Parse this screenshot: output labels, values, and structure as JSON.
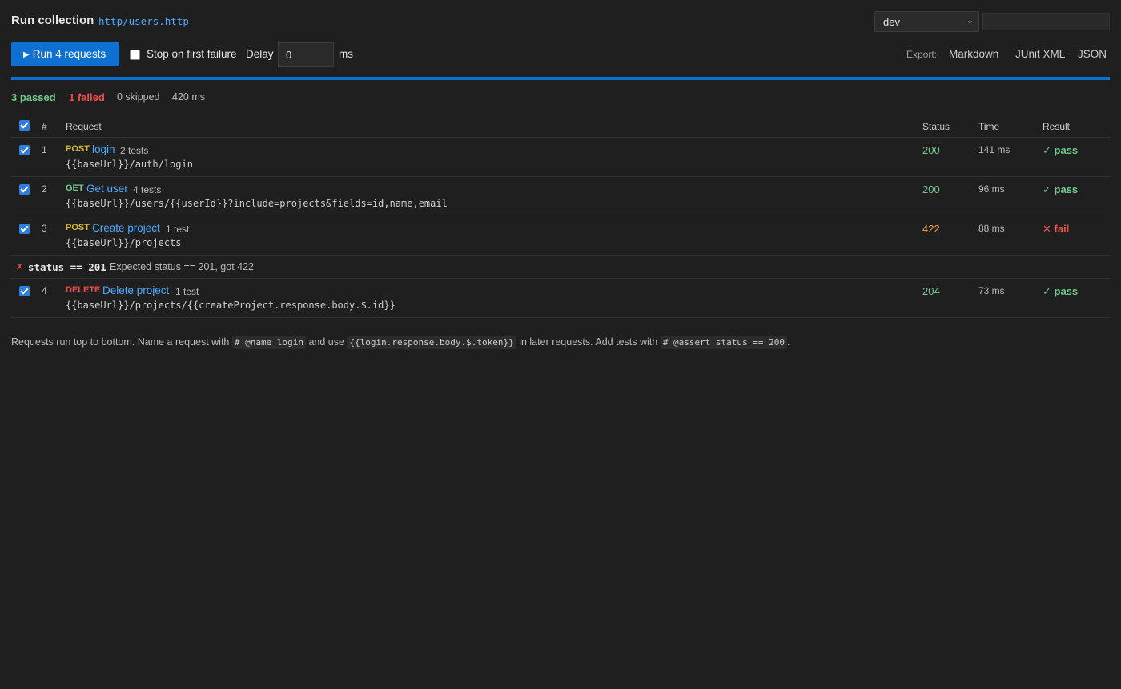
{
  "header": {
    "title": "Run collection",
    "file": "http/users.http",
    "environment": "dev"
  },
  "toolbar": {
    "run_label": "Run 4 requests",
    "stop_on_failure_label": "Stop on first failure",
    "stop_on_failure_checked": false,
    "delay_label": "Delay",
    "delay_value": "0",
    "delay_unit": "ms",
    "export_label": "Export:",
    "export_options": [
      "Markdown",
      "JUnit XML",
      "JSON"
    ]
  },
  "progress": {
    "fraction": 1.0
  },
  "summary": {
    "passed": "3 passed",
    "failed": "1 failed",
    "skipped": "0 skipped",
    "duration": "420 ms"
  },
  "table": {
    "headers": {
      "num": "#",
      "request": "Request",
      "status": "Status",
      "time": "Time",
      "result": "Result"
    },
    "rows": [
      {
        "num": "1",
        "method": "POST",
        "name": "login",
        "tests": "2 tests",
        "url": "{{baseUrl}}/auth/login",
        "status": "200",
        "time": "141 ms",
        "result": "pass"
      },
      {
        "num": "2",
        "method": "GET",
        "name": "Get user",
        "tests": "4 tests",
        "url": "{{baseUrl}}/users/{{userId}}?include=projects&fields=id,name,email",
        "status": "200",
        "time": "96 ms",
        "result": "pass"
      },
      {
        "num": "3",
        "method": "POST",
        "name": "Create project",
        "tests": "1 test",
        "url": "{{baseUrl}}/projects",
        "status": "422",
        "time": "88 ms",
        "result": "fail"
      },
      {
        "num": "4",
        "method": "DELETE",
        "name": "Delete project",
        "tests": "1 test",
        "url": "{{baseUrl}}/projects/{{createProject.response.body.$.id}}",
        "status": "204",
        "time": "73 ms",
        "result": "pass"
      }
    ],
    "failure": {
      "marker": "✗",
      "expression": "status == 201",
      "message": "Expected status == 201, got 422"
    }
  },
  "hint": {
    "t1": "Requests run top to bottom. Name a request with",
    "c1": "# @name login",
    "t2": "and use",
    "c2": "{{login.response.body.$.token}}",
    "t3": "in later requests. Add tests with",
    "c3": "# @assert status == 200",
    "t4": "."
  },
  "colors": {
    "accent": "#0e71d1",
    "pass": "#73c991",
    "fail": "#f14c4c",
    "warn_status": "#e5a044",
    "post_get_method": "#d7ba2c",
    "link": "#4daafc"
  }
}
